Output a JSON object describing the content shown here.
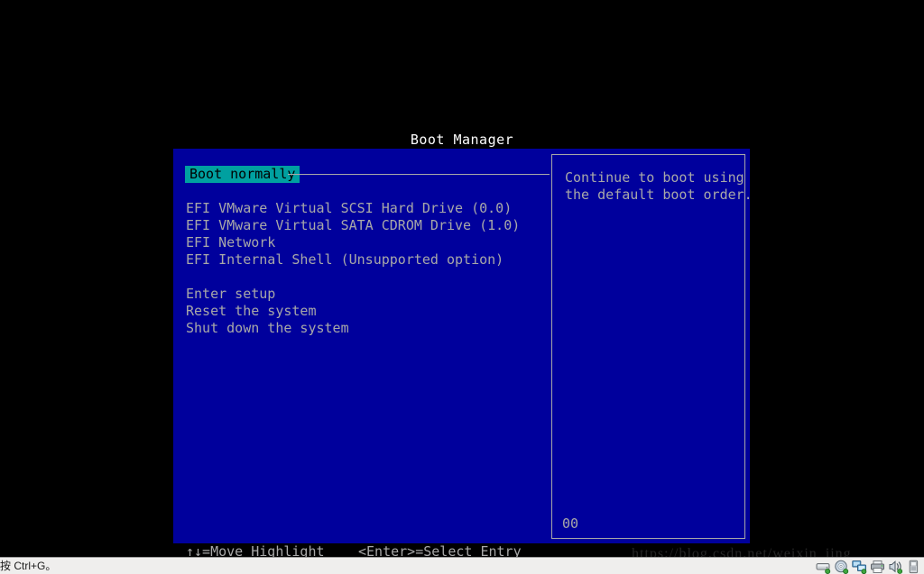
{
  "firmware": {
    "title": "Boot Manager",
    "menu": {
      "selected_index": 0,
      "items": [
        {
          "label": "Boot normally",
          "selected": true
        },
        {
          "label": "EFI VMware Virtual SCSI Hard Drive (0.0)",
          "selected": false
        },
        {
          "label": "EFI VMware Virtual SATA CDROM Drive (1.0)",
          "selected": false
        },
        {
          "label": "EFI Network",
          "selected": false
        },
        {
          "label": "EFI Internal Shell (Unsupported option)",
          "selected": false
        },
        {
          "label": "Enter setup",
          "selected": false
        },
        {
          "label": "Reset the system",
          "selected": false
        },
        {
          "label": "Shut down the system",
          "selected": false
        }
      ]
    },
    "help": {
      "lines": [
        "Continue to boot using",
        "the default boot order."
      ],
      "counter": "00"
    },
    "hints": {
      "move": "↑↓=Move Highlight",
      "select": "<Enter>=Select Entry"
    },
    "colors": {
      "panel_blue": "#00009c",
      "highlight_teal": "#00a0a0",
      "text_gray": "#a8a8a8",
      "title_white": "#ffffff",
      "backdrop_black": "#000000"
    }
  },
  "watermark": {
    "text": "https://blog.csdn.net/weixin_jing"
  },
  "taskbar": {
    "status_text": "按 Ctrl+G。",
    "tray_icons": [
      {
        "name": "hard-disk-icon",
        "title": "Hard Disk"
      },
      {
        "name": "cd-dvd-icon",
        "title": "CD/DVD"
      },
      {
        "name": "network-adapter-icon",
        "title": "Network Adapter"
      },
      {
        "name": "printer-icon",
        "title": "Printer"
      },
      {
        "name": "sound-card-icon",
        "title": "Sound Card"
      },
      {
        "name": "usb-device-icon",
        "title": "USB Device"
      }
    ]
  }
}
